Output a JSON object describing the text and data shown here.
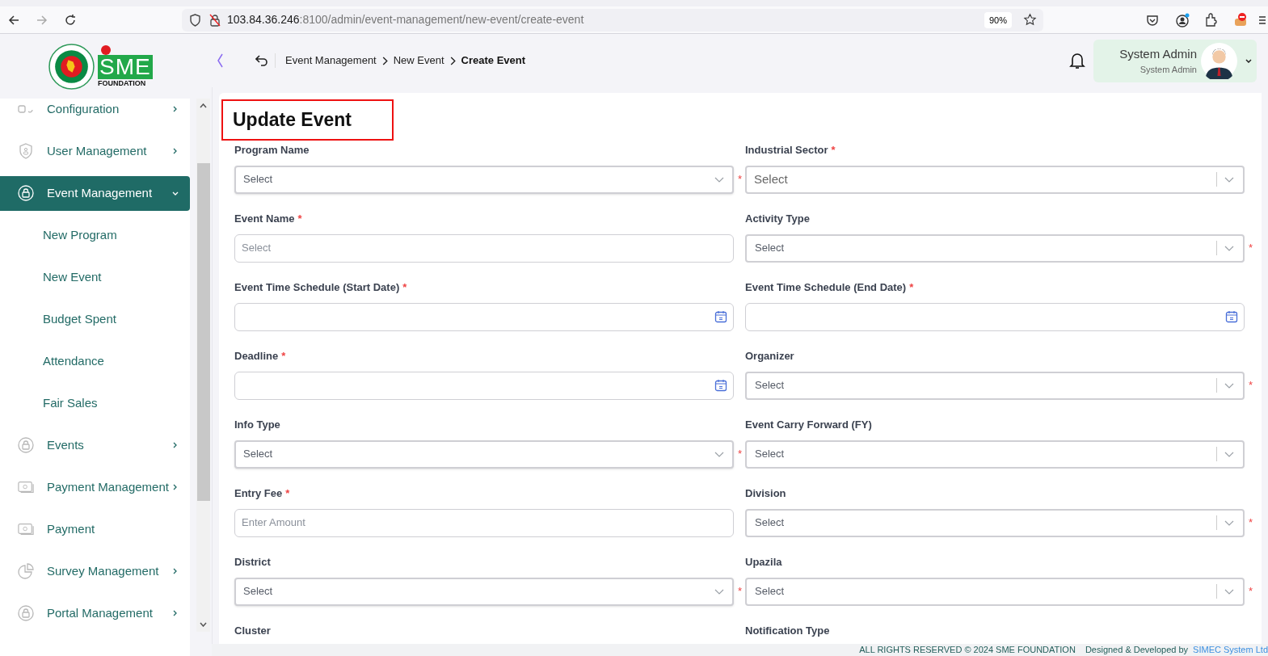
{
  "browser": {
    "url_host": "103.84.36.246",
    "url_rest": ":8100/admin/event-management/new-event/create-event",
    "zoom": "90%"
  },
  "logo": {
    "wordmark": "SME",
    "caption": "FOUNDATION"
  },
  "breadcrumb": [
    {
      "label": "Event Management",
      "current": false
    },
    {
      "label": "New Event",
      "current": false
    },
    {
      "label": "Create Event",
      "current": true
    }
  ],
  "user": {
    "name": "System Admin",
    "role": "System Admin"
  },
  "sidebar": {
    "items": [
      {
        "label": "Configuration",
        "expanded": false,
        "selected": false
      },
      {
        "label": "User Management",
        "expanded": false,
        "selected": false
      },
      {
        "label": "Event Management",
        "expanded": true,
        "selected": true,
        "children": [
          {
            "label": "New Program"
          },
          {
            "label": "New Event"
          },
          {
            "label": "Budget Spent"
          },
          {
            "label": "Attendance"
          },
          {
            "label": "Fair Sales"
          }
        ]
      },
      {
        "label": "Events",
        "expanded": false,
        "selected": false
      },
      {
        "label": "Payment Management",
        "expanded": false,
        "selected": false
      },
      {
        "label": "Payment",
        "selected": false
      },
      {
        "label": "Survey Management",
        "expanded": false,
        "selected": false
      },
      {
        "label": "Portal Management",
        "expanded": false,
        "selected": false
      }
    ]
  },
  "form": {
    "title": "Update Event",
    "required_mark": "*",
    "rows": [
      [
        {
          "label": "Program Name",
          "kind": "select",
          "required": true,
          "mark_after_field": true,
          "placeholder": "Select"
        },
        {
          "label": "Industrial Sector",
          "kind": "combo_large",
          "required": true,
          "mark_after_field": false,
          "placeholder": "Select"
        }
      ],
      [
        {
          "label": "Event Name",
          "kind": "text",
          "required": true,
          "mark_after_field": false,
          "placeholder": "Select"
        },
        {
          "label": "Activity Type",
          "kind": "combo",
          "required": true,
          "mark_after_field": true,
          "placeholder": "Select"
        }
      ],
      [
        {
          "label": "Event Time Schedule (Start Date)",
          "kind": "date",
          "required": true,
          "mark_after_field": false
        },
        {
          "label": "Event Time Schedule (End Date)",
          "kind": "date",
          "required": true,
          "mark_after_field": false
        }
      ],
      [
        {
          "label": "Deadline",
          "kind": "date",
          "required": true,
          "mark_after_field": false
        },
        {
          "label": "Organizer",
          "kind": "combo",
          "required": true,
          "mark_after_field": true,
          "placeholder": "Select"
        }
      ],
      [
        {
          "label": "Info Type",
          "kind": "select",
          "required": true,
          "mark_after_field": true,
          "placeholder": "Select"
        },
        {
          "label": "Event Carry Forward (FY)",
          "kind": "combo",
          "required": false,
          "placeholder": "Select"
        }
      ],
      [
        {
          "label": "Entry Fee",
          "kind": "text",
          "required": true,
          "mark_after_field": false,
          "placeholder": "Enter Amount"
        },
        {
          "label": "Division",
          "kind": "combo",
          "required": true,
          "mark_after_field": true,
          "placeholder": "Select"
        }
      ],
      [
        {
          "label": "District",
          "kind": "select",
          "required": true,
          "mark_after_field": true,
          "placeholder": "Select"
        },
        {
          "label": "Upazila",
          "kind": "combo",
          "required": true,
          "mark_after_field": true,
          "placeholder": "Select"
        }
      ],
      [
        {
          "label": "Cluster",
          "kind": "cut"
        },
        {
          "label": "Notification Type",
          "kind": "cut"
        }
      ]
    ]
  },
  "footer": {
    "rights": "ALL RIGHTS RESERVED © 2024 SME FOUNDATION",
    "credit": "Designed & Developed by",
    "company": "SIMEC System Ltd"
  }
}
